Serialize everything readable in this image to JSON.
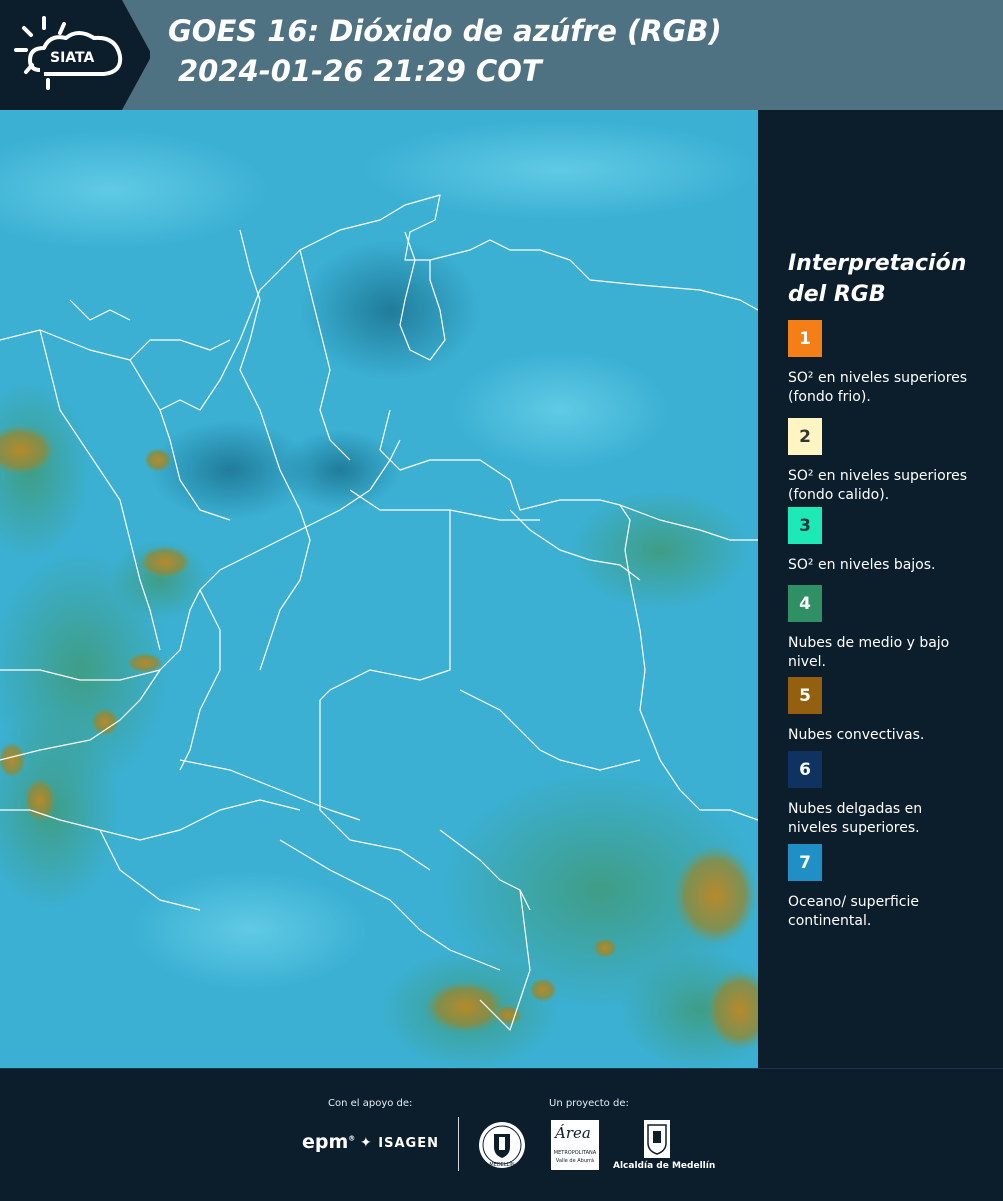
{
  "header": {
    "logo_text": "SIATA",
    "title_line1": "GOES 16: Dióxido de azúfre (RGB)",
    "title_line2": "2024-01-26 21:29 COT"
  },
  "legend": {
    "title_line1": "Interpretación",
    "title_line2": "del RGB",
    "items": [
      {
        "num": "1",
        "color": "#f57f17",
        "text_color": "#ffffff",
        "label": "SO² en niveles superiores (fondo frio)."
      },
      {
        "num": "2",
        "color": "#fff5c2",
        "text_color": "#333333",
        "label": "SO² en niveles superiores (fondo calido)."
      },
      {
        "num": "3",
        "color": "#1de9b6",
        "text_color": "#1b3a3a",
        "label": "SO² en niveles bajos."
      },
      {
        "num": "4",
        "color": "#2f8f65",
        "text_color": "#ffffff",
        "label": "Nubes de medio y bajo nivel."
      },
      {
        "num": "5",
        "color": "#946010",
        "text_color": "#ffffff",
        "label": "Nubes convectivas."
      },
      {
        "num": "6",
        "color": "#0f3260",
        "text_color": "#ffffff",
        "label": "Nubes delgadas en niveles superiores."
      },
      {
        "num": "7",
        "color": "#1f8fc6",
        "text_color": "#ffffff",
        "label": "Oceano/ superficie continental."
      }
    ]
  },
  "footer": {
    "support_label": "Con el apoyo de:",
    "project_label": "Un proyecto de:",
    "epm": "epm",
    "isagen": "ISAGEN",
    "area_name": "Área",
    "area_sub1": "METROPOLITANA",
    "area_sub2": "Valle de Aburrá",
    "alcaldia": "Alcaldía de Medellín",
    "medellin_seal": "MEDELLÍN"
  },
  "colors": {
    "header_bg": "#4f7282",
    "logo_bg": "#0c1e2c",
    "panel_bg": "#0c1e2c",
    "ocean": "#3bb0d3",
    "land": "#45b7d6",
    "border_lines": "#ffffff"
  }
}
